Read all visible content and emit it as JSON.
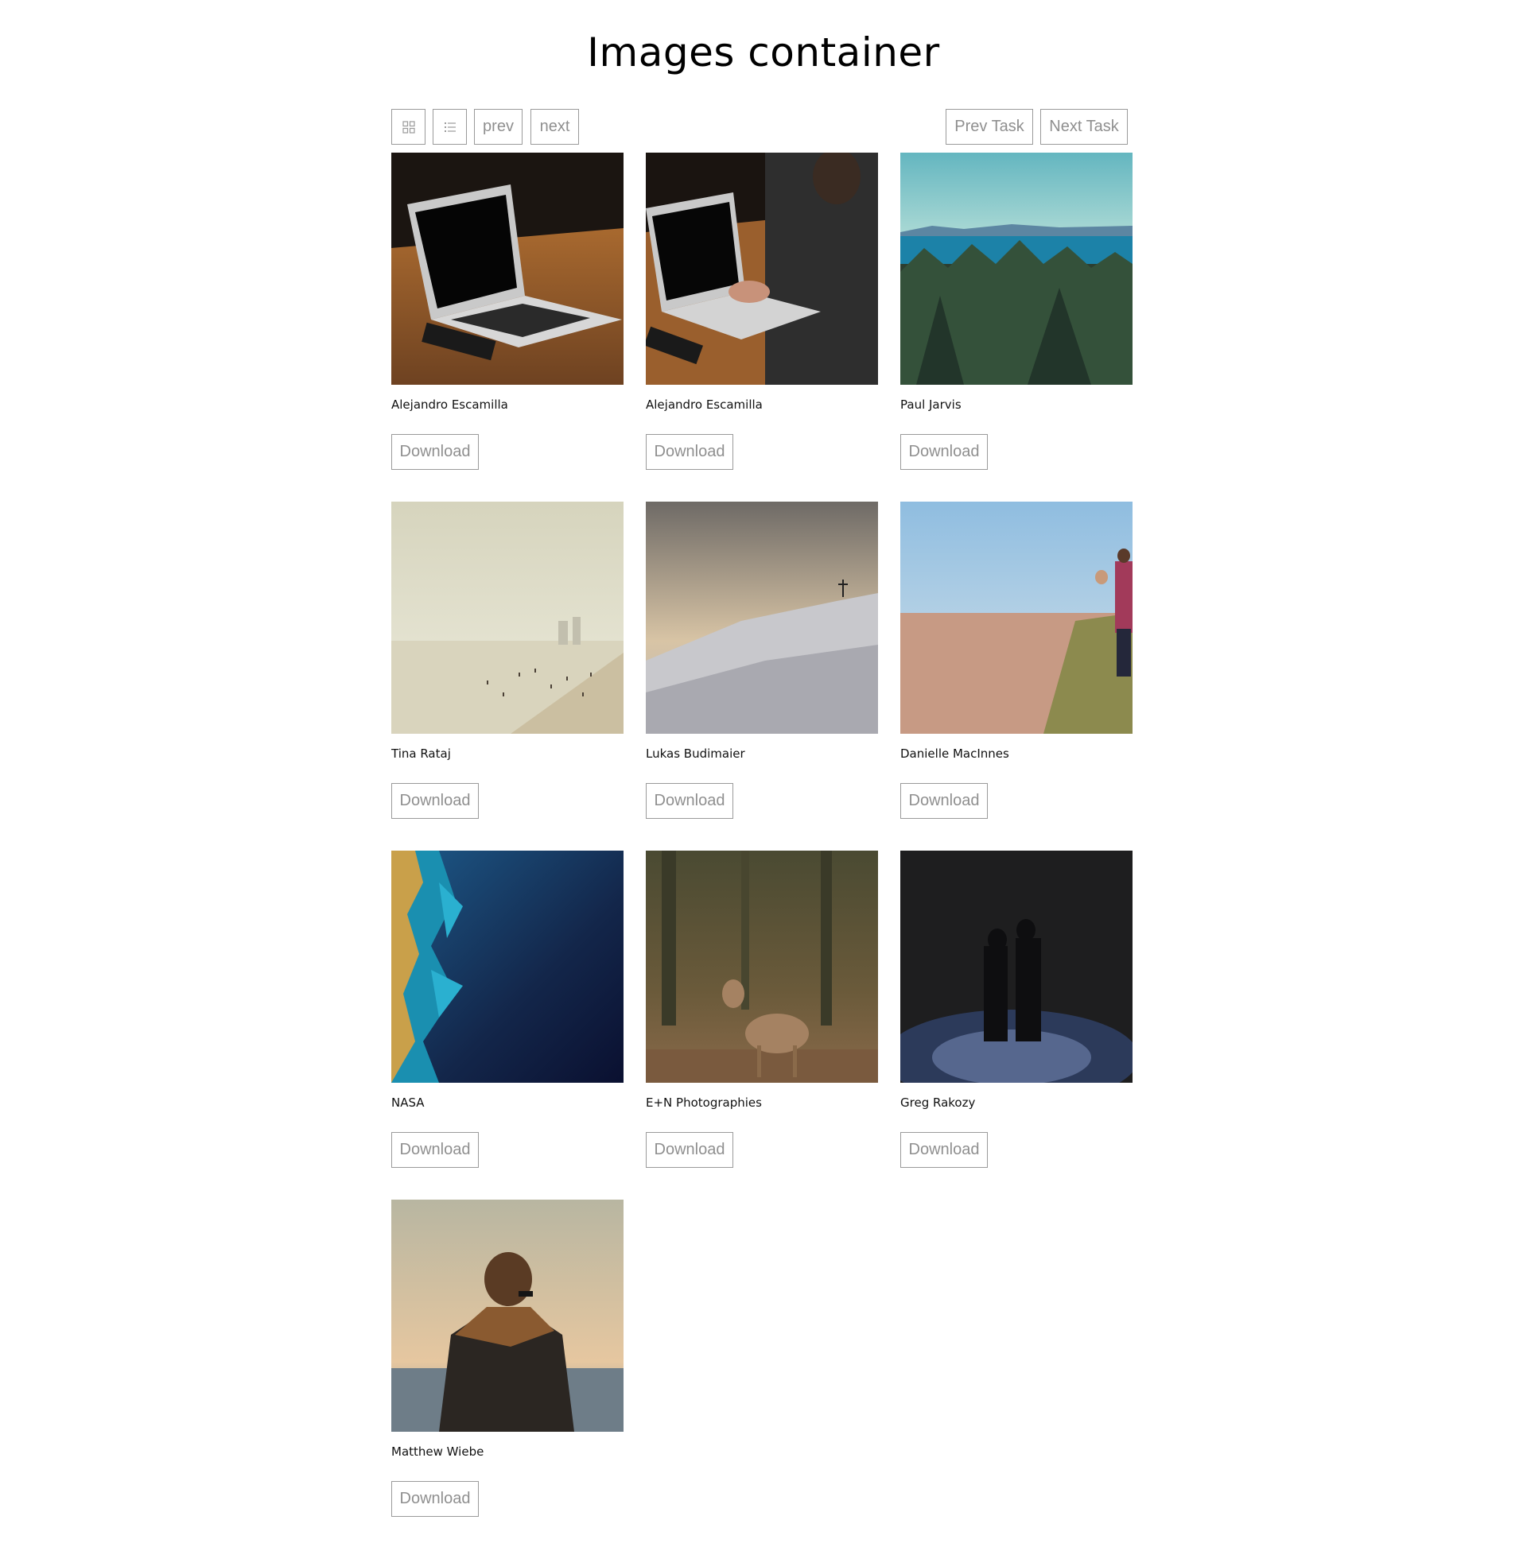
{
  "header": {
    "title": "Images container"
  },
  "toolbar": {
    "prev_label": "prev",
    "next_label": "next",
    "prev_task_label": "Prev Task",
    "next_task_label": "Next Task"
  },
  "photos": [
    {
      "author": "Alejandro Escamilla",
      "download_label": "Download"
    },
    {
      "author": "Alejandro Escamilla",
      "download_label": "Download"
    },
    {
      "author": "Paul Jarvis",
      "download_label": "Download"
    },
    {
      "author": "Tina Rataj",
      "download_label": "Download"
    },
    {
      "author": "Lukas Budimaier",
      "download_label": "Download"
    },
    {
      "author": "Danielle MacInnes",
      "download_label": "Download"
    },
    {
      "author": "NASA",
      "download_label": "Download"
    },
    {
      "author": "E+N Photographies",
      "download_label": "Download"
    },
    {
      "author": "Greg Rakozy",
      "download_label": "Download"
    },
    {
      "author": "Matthew Wiebe",
      "download_label": "Download"
    }
  ],
  "icons": {
    "grid": "grid-view-icon",
    "list": "list-view-icon"
  }
}
